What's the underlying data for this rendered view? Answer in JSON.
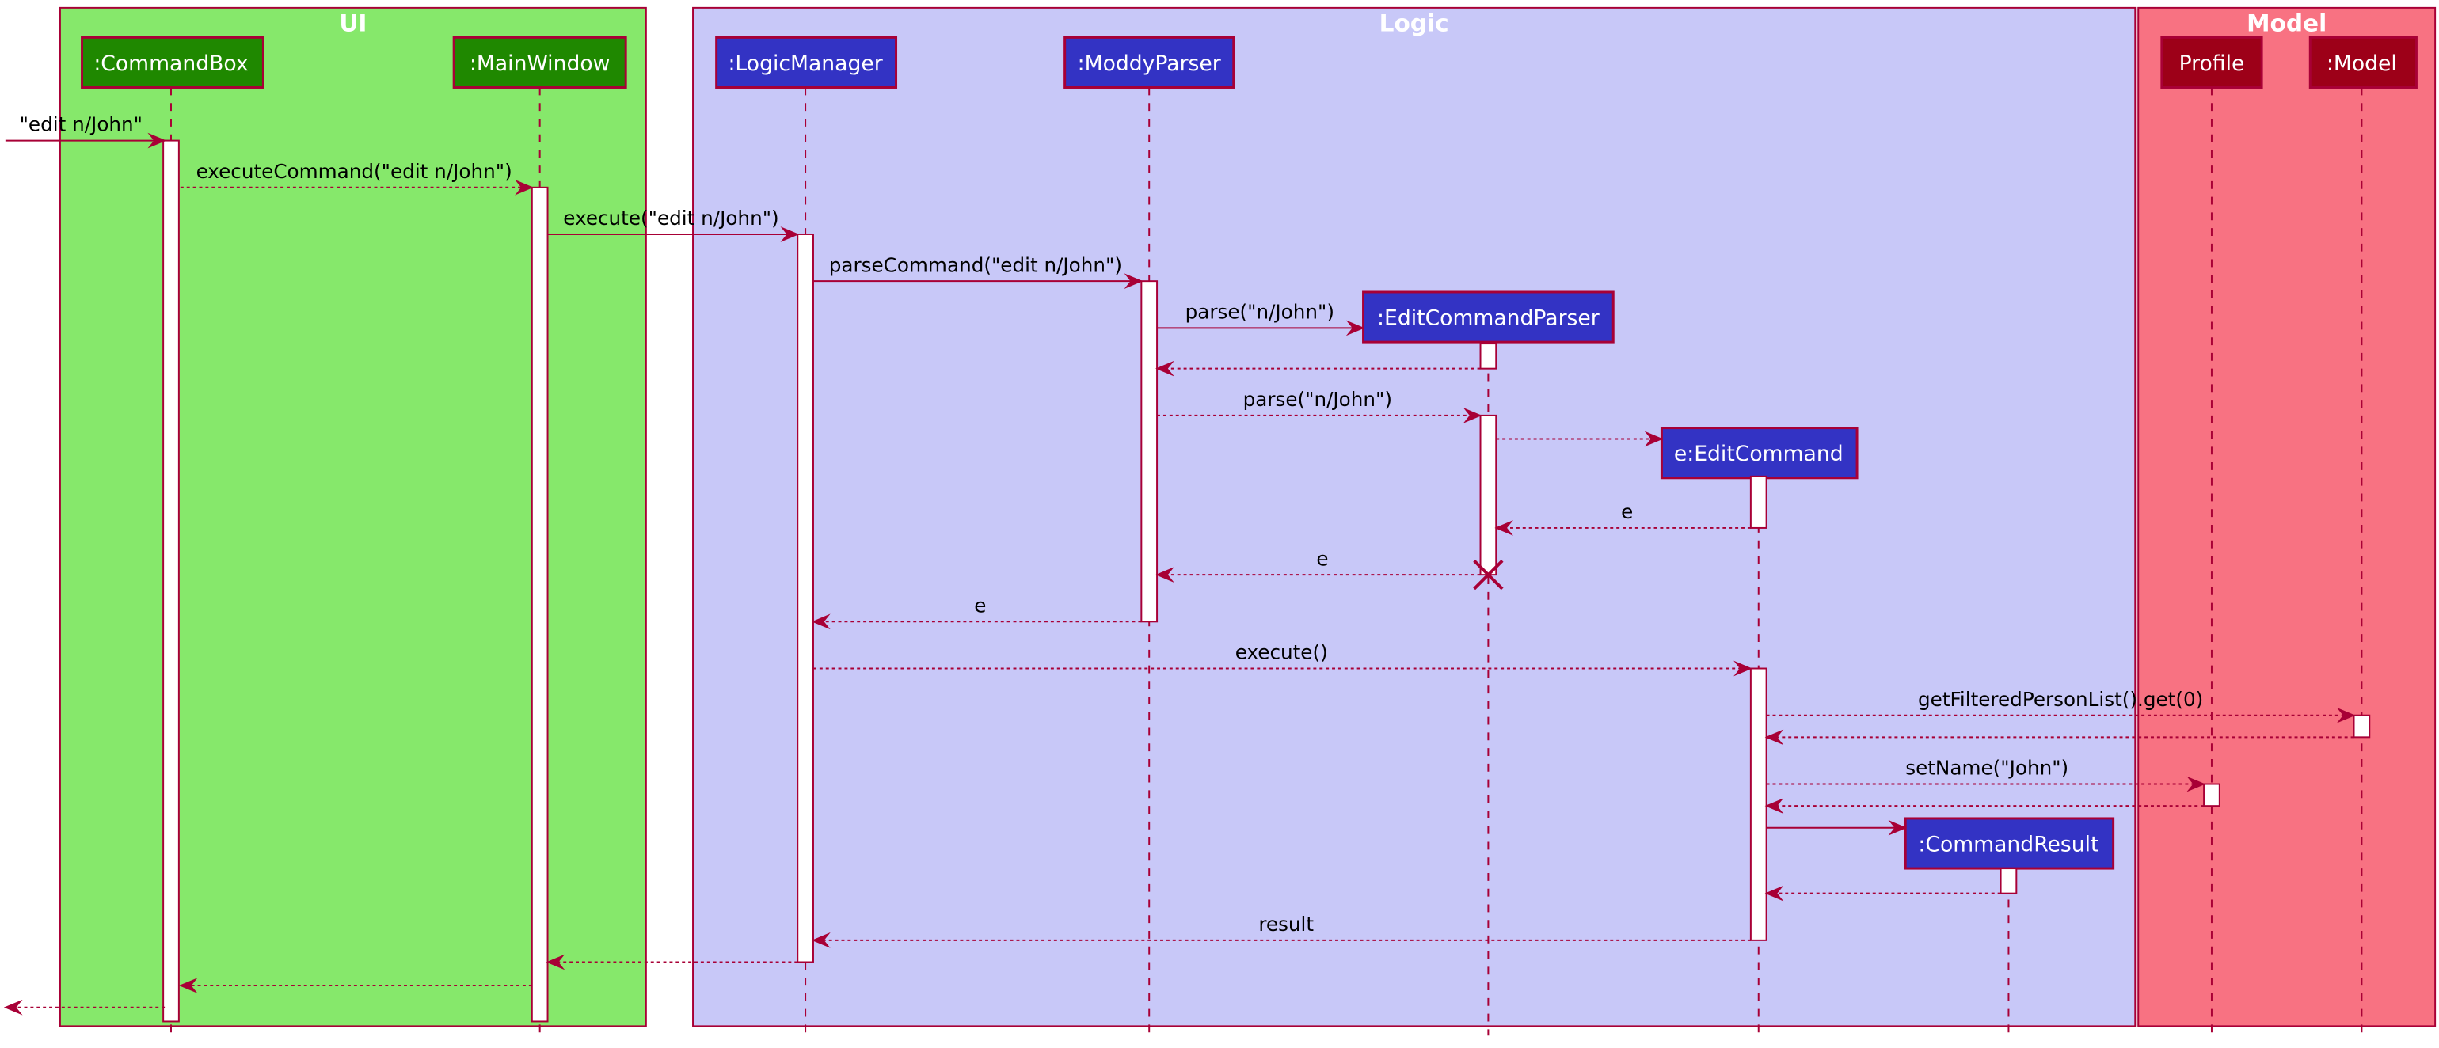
{
  "colors": {
    "ui_group": "#86e86b",
    "logic_group": "#c8c8f8",
    "model_group": "#f87282",
    "ui_participant": "#1f8800",
    "logic_participant": "#3333c4",
    "model_participant": "#9d0018",
    "line": "#a80036"
  },
  "groups": [
    {
      "title": "UI"
    },
    {
      "title": "Logic"
    },
    {
      "title": "Model"
    }
  ],
  "participants": [
    {
      "name": ":CommandBox",
      "group": "UI"
    },
    {
      "name": ":MainWindow",
      "group": "UI"
    },
    {
      "name": ":LogicManager",
      "group": "Logic"
    },
    {
      "name": ":ModdyParser",
      "group": "Logic"
    },
    {
      "name": ":EditCommandParser",
      "group": "Logic"
    },
    {
      "name": "e:EditCommand",
      "group": "Logic"
    },
    {
      "name": ":CommandResult",
      "group": "Logic"
    },
    {
      "name": "Profile",
      "group": "Model"
    },
    {
      "name": ":Model",
      "group": "Model"
    }
  ],
  "messages": [
    {
      "label": "\"edit n/John\"",
      "type": "call"
    },
    {
      "label": "executeCommand(\"edit n/John\")",
      "type": "return-style"
    },
    {
      "label": "execute(\"edit n/John\")",
      "type": "call"
    },
    {
      "label": "parseCommand(\"edit n/John\")",
      "type": "call"
    },
    {
      "label": "parse(\"n/John\")",
      "type": "create"
    },
    {
      "label": "",
      "type": "return"
    },
    {
      "label": "parse(\"n/John\")",
      "type": "dotted-call"
    },
    {
      "label": "",
      "type": "create"
    },
    {
      "label": "e",
      "type": "return"
    },
    {
      "label": "e",
      "type": "return"
    },
    {
      "label": "e",
      "type": "return"
    },
    {
      "label": "execute()",
      "type": "dotted-call"
    },
    {
      "label": "getFilteredPersonList().get(0)",
      "type": "dotted-call"
    },
    {
      "label": "",
      "type": "return"
    },
    {
      "label": "setName(\"John\")",
      "type": "dotted-call"
    },
    {
      "label": "",
      "type": "return"
    },
    {
      "label": "",
      "type": "create"
    },
    {
      "label": "",
      "type": "return"
    },
    {
      "label": "result",
      "type": "return"
    },
    {
      "label": "",
      "type": "return"
    },
    {
      "label": "",
      "type": "return"
    },
    {
      "label": "",
      "type": "return"
    }
  ]
}
